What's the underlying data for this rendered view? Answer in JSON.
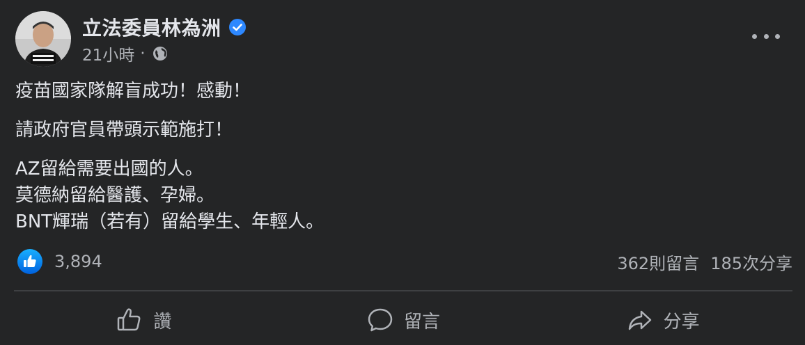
{
  "post": {
    "author": "立法委員林為洲",
    "time": "21小時",
    "dot": "·",
    "icons": {
      "verified": "verified-badge-icon",
      "privacy": "globe-icon",
      "more": "more-options-icon",
      "like_badge": "like-reaction-icon"
    },
    "body": {
      "line1": "疫苗國家隊解盲成功！感動！",
      "line2": "請政府官員帶頭示範施打！",
      "line3": "AZ留給需要出國的人。",
      "line4": "莫德納留給醫護、孕婦。",
      "line5": "BNT輝瑞（若有）留給學生、年輕人。"
    },
    "stats": {
      "likes": "3,894",
      "comments": "362則留言",
      "shares": "185次分享"
    },
    "actions": {
      "like": "讚",
      "comment": "留言",
      "share": "分享"
    },
    "colors": {
      "background": "#242526",
      "text": "#e4e6eb",
      "secondary_text": "#b0b3b8",
      "accent": "#2d88ff"
    }
  }
}
